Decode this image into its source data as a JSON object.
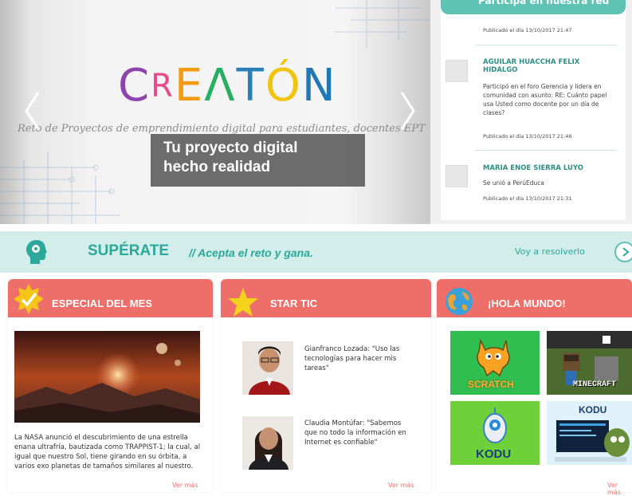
{
  "hero": {
    "logo": [
      "C",
      "R",
      "E",
      "Λ",
      "T",
      "Ó",
      "N"
    ],
    "logo_colors": [
      "#8e44ad",
      "#e84c88",
      "#f39c12",
      "#27ae60",
      "#2980b9",
      "#f1c40f",
      "#1f77b4"
    ],
    "tagline": "Reto de Proyectos de emprendimiento digital para estudiantes, docentes EPT y CIST",
    "overlay_line1": "Tu proyecto digital",
    "overlay_line2": "hecho realidad"
  },
  "activity": {
    "header": "Participa en nuestra red",
    "items": [
      {
        "published": "Publicado el día 13/10/2017 21:47"
      },
      {
        "name": "AGUILAR HUACCHA FELIX HIDALGO",
        "text": "Participó en el foro Gerencia y lidera en comunidad con asunto: RE: Cuánto papel usa Usted como docente por un día de clases?",
        "published": "Publicado el día 13/10/2017 21:46"
      },
      {
        "name": "MARIA ENOE SIERRA LUYO",
        "text": "Se unió a PerúEduca",
        "published": "Publicado el día 13/10/2017 21:31"
      }
    ]
  },
  "superate": {
    "title": "SUPÉRATE",
    "subtitle": "// Acepta el reto y gana.",
    "link": "Voy a resolverlo"
  },
  "cards": {
    "especial": {
      "title": "ESPECIAL DEL MES",
      "text": "La NASA anunció el descubrimiento de una estrella enana ultrafría, bautizada como TRAPPIST-1; la cual, al igual que nuestro Sol, tiene girando en su órbita, a varios exo planetas de tamaños similares al nuestro.",
      "more": "Ver más"
    },
    "startic": {
      "title": "STAR TIC",
      "quote1": "Gianfranco Lozada: \"Uso las tecnologías para hacer mis tareas\"",
      "quote2": "Claudia Montúfar: \"Sabemos que no todo la información en Internet es confiable\"",
      "more": "Ver más"
    },
    "hola": {
      "title": "¡HOLA MUNDO!",
      "scratch": "SCRATCH",
      "minecraft": "MINECRAFT",
      "kodu": "KODU",
      "kodu_game": "KODU",
      "more": "Ver más"
    }
  }
}
